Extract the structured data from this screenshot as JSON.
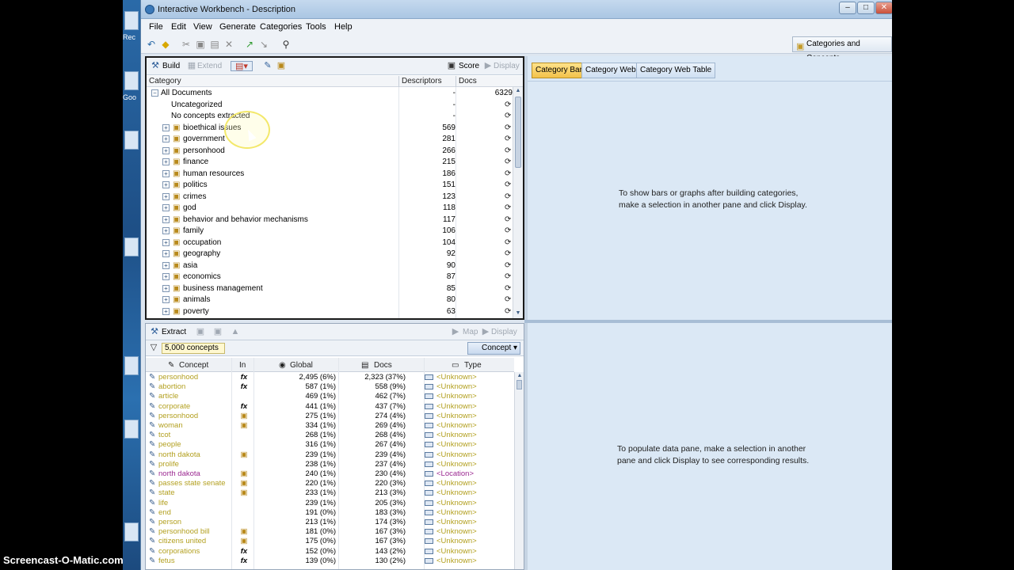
{
  "window": {
    "title": "Interactive Workbench - Description"
  },
  "menu": [
    "File",
    "Edit",
    "View",
    "Generate",
    "Categories",
    "Tools",
    "Help"
  ],
  "toolbar": {
    "categories_and_concepts": "Categories and Concepts"
  },
  "category_pane": {
    "build": "Build",
    "extend": "Extend",
    "score": "Score",
    "display": "Display",
    "headers": {
      "category": "Category",
      "descriptors": "Descriptors",
      "docs": "Docs"
    },
    "rows": [
      {
        "label": "All Documents",
        "desc": "-",
        "docs": "6329",
        "level": 0,
        "expander": "minus",
        "bag": false
      },
      {
        "label": "Uncategorized",
        "desc": "-",
        "docs": "",
        "level": 1,
        "expander": "none",
        "bag": false
      },
      {
        "label": "No concepts extracted",
        "desc": "-",
        "docs": "",
        "level": 1,
        "expander": "none",
        "bag": false
      },
      {
        "label": "bioethical issues",
        "desc": "569",
        "docs": "",
        "level": 1,
        "expander": "plus",
        "bag": true
      },
      {
        "label": "government",
        "desc": "281",
        "docs": "",
        "level": 1,
        "expander": "plus",
        "bag": true
      },
      {
        "label": "personhood",
        "desc": "266",
        "docs": "",
        "level": 1,
        "expander": "plus",
        "bag": true
      },
      {
        "label": "finance",
        "desc": "215",
        "docs": "",
        "level": 1,
        "expander": "plus",
        "bag": true
      },
      {
        "label": "human resources",
        "desc": "186",
        "docs": "",
        "level": 1,
        "expander": "plus",
        "bag": true
      },
      {
        "label": "politics",
        "desc": "151",
        "docs": "",
        "level": 1,
        "expander": "plus",
        "bag": true
      },
      {
        "label": "crimes",
        "desc": "123",
        "docs": "",
        "level": 1,
        "expander": "plus",
        "bag": true
      },
      {
        "label": "god",
        "desc": "118",
        "docs": "",
        "level": 1,
        "expander": "plus",
        "bag": true
      },
      {
        "label": "behavior and behavior mechanisms",
        "desc": "117",
        "docs": "",
        "level": 1,
        "expander": "plus",
        "bag": true
      },
      {
        "label": "family",
        "desc": "106",
        "docs": "",
        "level": 1,
        "expander": "plus",
        "bag": true
      },
      {
        "label": "occupation",
        "desc": "104",
        "docs": "",
        "level": 1,
        "expander": "plus",
        "bag": true
      },
      {
        "label": "geography",
        "desc": "92",
        "docs": "",
        "level": 1,
        "expander": "plus",
        "bag": true
      },
      {
        "label": "asia",
        "desc": "90",
        "docs": "",
        "level": 1,
        "expander": "plus",
        "bag": true
      },
      {
        "label": "economics",
        "desc": "87",
        "docs": "",
        "level": 1,
        "expander": "plus",
        "bag": true
      },
      {
        "label": "business management",
        "desc": "85",
        "docs": "",
        "level": 1,
        "expander": "plus",
        "bag": true
      },
      {
        "label": "animals",
        "desc": "80",
        "docs": "",
        "level": 1,
        "expander": "plus",
        "bag": true
      },
      {
        "label": "poverty",
        "desc": "63",
        "docs": "",
        "level": 1,
        "expander": "plus",
        "bag": true
      }
    ]
  },
  "concept_pane": {
    "extract": "Extract",
    "map": "Map",
    "display": "Display",
    "count": "5,000 concepts",
    "concept_dropdown": "Concept",
    "headers": {
      "concept": "Concept",
      "in": "In",
      "global": "Global",
      "docs": "Docs",
      "type": "Type"
    },
    "rows": [
      {
        "name": "personhood",
        "in": "fx",
        "global": "2,495 (6%)",
        "docs": "2,323 (37%)",
        "type": "<Unknown>"
      },
      {
        "name": "abortion",
        "in": "fx",
        "global": "587 (1%)",
        "docs": "558 (9%)",
        "type": "<Unknown>"
      },
      {
        "name": "article",
        "in": "",
        "global": "469 (1%)",
        "docs": "462 (7%)",
        "type": "<Unknown>"
      },
      {
        "name": "corporate",
        "in": "fx",
        "global": "441 (1%)",
        "docs": "437 (7%)",
        "type": "<Unknown>"
      },
      {
        "name": "personhood",
        "in": "bag",
        "global": "275 (1%)",
        "docs": "274 (4%)",
        "type": "<Unknown>"
      },
      {
        "name": "woman",
        "in": "bag",
        "global": "334 (1%)",
        "docs": "269 (4%)",
        "type": "<Unknown>"
      },
      {
        "name": "tcot",
        "in": "",
        "global": "268 (1%)",
        "docs": "268 (4%)",
        "type": "<Unknown>"
      },
      {
        "name": "people",
        "in": "",
        "global": "316 (1%)",
        "docs": "267 (4%)",
        "type": "<Unknown>"
      },
      {
        "name": "north dakota",
        "in": "bag",
        "global": "239 (1%)",
        "docs": "239 (4%)",
        "type": "<Unknown>"
      },
      {
        "name": "prolife",
        "in": "",
        "global": "238 (1%)",
        "docs": "237 (4%)",
        "type": "<Unknown>"
      },
      {
        "name": "north dakota",
        "in": "bag",
        "global": "240 (1%)",
        "docs": "230 (4%)",
        "type": "<Location>"
      },
      {
        "name": "passes state senate",
        "in": "bag",
        "global": "220 (1%)",
        "docs": "220 (3%)",
        "type": "<Unknown>"
      },
      {
        "name": "state",
        "in": "bag",
        "global": "233 (1%)",
        "docs": "213 (3%)",
        "type": "<Unknown>"
      },
      {
        "name": "life",
        "in": "",
        "global": "239 (1%)",
        "docs": "205 (3%)",
        "type": "<Unknown>"
      },
      {
        "name": "end",
        "in": "",
        "global": "191 (0%)",
        "docs": "183 (3%)",
        "type": "<Unknown>"
      },
      {
        "name": "person",
        "in": "",
        "global": "213 (1%)",
        "docs": "174 (3%)",
        "type": "<Unknown>"
      },
      {
        "name": "personhood bill",
        "in": "bag",
        "global": "181 (0%)",
        "docs": "167 (3%)",
        "type": "<Unknown>"
      },
      {
        "name": "citizens united",
        "in": "bag",
        "global": "175 (0%)",
        "docs": "167 (3%)",
        "type": "<Unknown>"
      },
      {
        "name": "corporations",
        "in": "fx",
        "global": "152 (0%)",
        "docs": "143 (2%)",
        "type": "<Unknown>"
      },
      {
        "name": "fetus",
        "in": "fx",
        "global": "139 (0%)",
        "docs": "130 (2%)",
        "type": "<Unknown>"
      }
    ]
  },
  "viz_pane": {
    "tabs": [
      "Category Bar",
      "Category Web",
      "Category Web Table"
    ],
    "message_line1": "To show bars or graphs after building categories,",
    "message_line2": "make a selection in another pane and click Display."
  },
  "data_pane": {
    "message_line1": "To populate data pane, make a selection in another",
    "message_line2": "pane and click Display to see corresponding results."
  },
  "watermark": "Screencast-O-Matic.com"
}
